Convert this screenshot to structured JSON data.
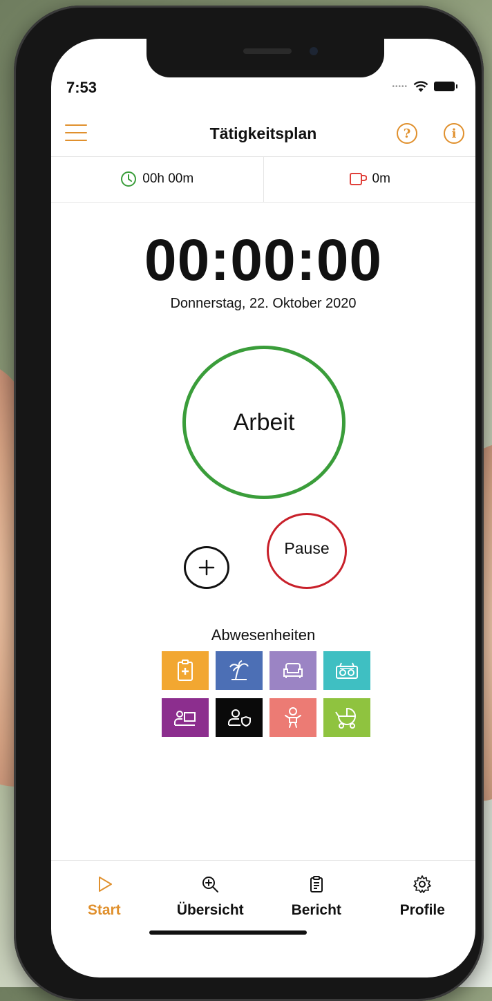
{
  "status_bar": {
    "time": "7:53"
  },
  "nav": {
    "title": "Tätigkeitsplan",
    "help_glyph": "?",
    "info_glyph": "i"
  },
  "summary": {
    "work_time": "00h 00m",
    "break_time": "0m"
  },
  "timer": {
    "value": "00:00:00",
    "date": "Donnerstag, 22. Oktober 2020"
  },
  "buttons": {
    "work": "Arbeit",
    "pause": "Pause"
  },
  "absences": {
    "title": "Abwesenheiten",
    "tiles": [
      {
        "icon": "sick-note-icon",
        "color": "#f2a731"
      },
      {
        "icon": "vacation-palm-icon",
        "color": "#4c6fb5"
      },
      {
        "icon": "sofa-icon",
        "color": "#9b84c4"
      },
      {
        "icon": "radio-icon",
        "color": "#3fbfc2"
      },
      {
        "icon": "training-presentation-icon",
        "color": "#8c2e8e"
      },
      {
        "icon": "person-shield-icon",
        "color": "#0a0a0a"
      },
      {
        "icon": "baby-icon",
        "color": "#ec7b74"
      },
      {
        "icon": "stroller-icon",
        "color": "#8fc33f"
      }
    ]
  },
  "tabbar": {
    "tabs": [
      {
        "label": "Start",
        "icon": "play-icon",
        "active": true
      },
      {
        "label": "Übersicht",
        "icon": "zoom-in-icon",
        "active": false
      },
      {
        "label": "Bericht",
        "icon": "clipboard-icon",
        "active": false
      },
      {
        "label": "Profile",
        "icon": "gear-icon",
        "active": false
      }
    ]
  },
  "colors": {
    "accent": "#e0902d",
    "work_green": "#3a9d3a",
    "pause_red": "#c8202a",
    "break_red": "#e0403a"
  }
}
